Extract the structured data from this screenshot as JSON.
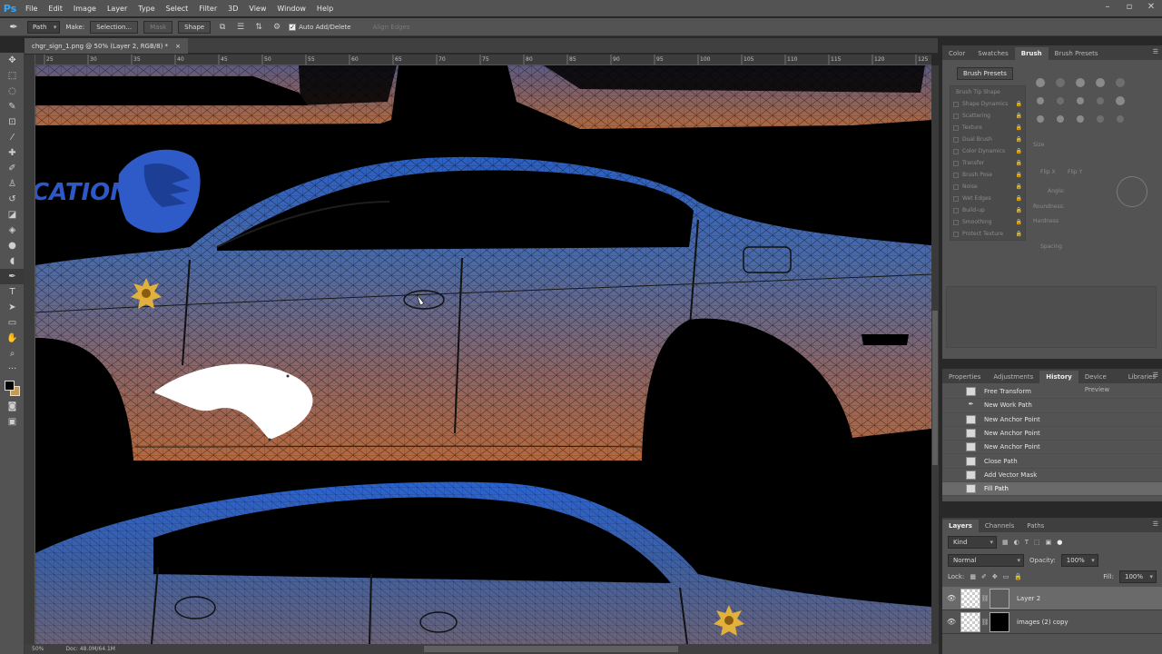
{
  "app": {
    "logo": "Ps",
    "menu": [
      "File",
      "Edit",
      "Image",
      "Layer",
      "Type",
      "Select",
      "Filter",
      "3D",
      "View",
      "Window",
      "Help"
    ]
  },
  "options_bar": {
    "mode_select": "Path",
    "make_label": "Make:",
    "selection_btn": "Selection...",
    "mask_btn": "Mask",
    "shape_btn": "Shape",
    "auto_add_delete": "Auto Add/Delete",
    "align_edges": "Align Edges"
  },
  "document": {
    "tab_title": "chgr_sign_1.png @ 50% (Layer 2, RGB/8) *",
    "close_glyph": "×",
    "ruler_ticks": [
      "25",
      "30",
      "35",
      "40",
      "45",
      "50",
      "55",
      "60",
      "65",
      "70",
      "75",
      "80",
      "85",
      "90",
      "95",
      "100",
      "105",
      "110",
      "115",
      "120",
      "125"
    ],
    "canvas_text": "CATIONS"
  },
  "status": {
    "zoom": "50%",
    "doc_size": "Doc: 48.0M/64.1M"
  },
  "brush_panel": {
    "tabs": [
      "Color",
      "Swatches",
      "Brush",
      "Brush Presets"
    ],
    "active_tab": "Brush",
    "presets_button": "Brush Presets",
    "tip_shape": "Brush Tip Shape",
    "options": [
      "Shape Dynamics",
      "Scattering",
      "Texture",
      "Dual Brush",
      "Color Dynamics",
      "Transfer",
      "Brush Pose",
      "Noise",
      "Wet Edges",
      "Build-up",
      "Smoothing",
      "Protect Texture"
    ],
    "size_label": "Size",
    "flip_x": "Flip X",
    "flip_y": "Flip Y",
    "angle_label": "Angle:",
    "roundness_label": "Roundness:",
    "hardness_label": "Hardness",
    "spacing_label": "Spacing"
  },
  "history_panel": {
    "tabs": [
      "Properties",
      "Adjustments",
      "History",
      "Device Preview",
      "Libraries"
    ],
    "active_tab": "History",
    "items": [
      "Free Transform",
      "New Work Path",
      "New Anchor Point",
      "New Anchor Point",
      "New Anchor Point",
      "Close Path",
      "Add Vector Mask",
      "Fill Path"
    ]
  },
  "layers_panel": {
    "tabs": [
      "Layers",
      "Channels",
      "Paths"
    ],
    "active_tab": "Layers",
    "kind_filter": "Kind",
    "blend_mode": "Normal",
    "opacity_label": "Opacity:",
    "opacity_value": "100%",
    "lock_label": "Lock:",
    "fill_label": "Fill:",
    "fill_value": "100%",
    "layers": [
      "Layer 2",
      "images (2) copy"
    ]
  }
}
